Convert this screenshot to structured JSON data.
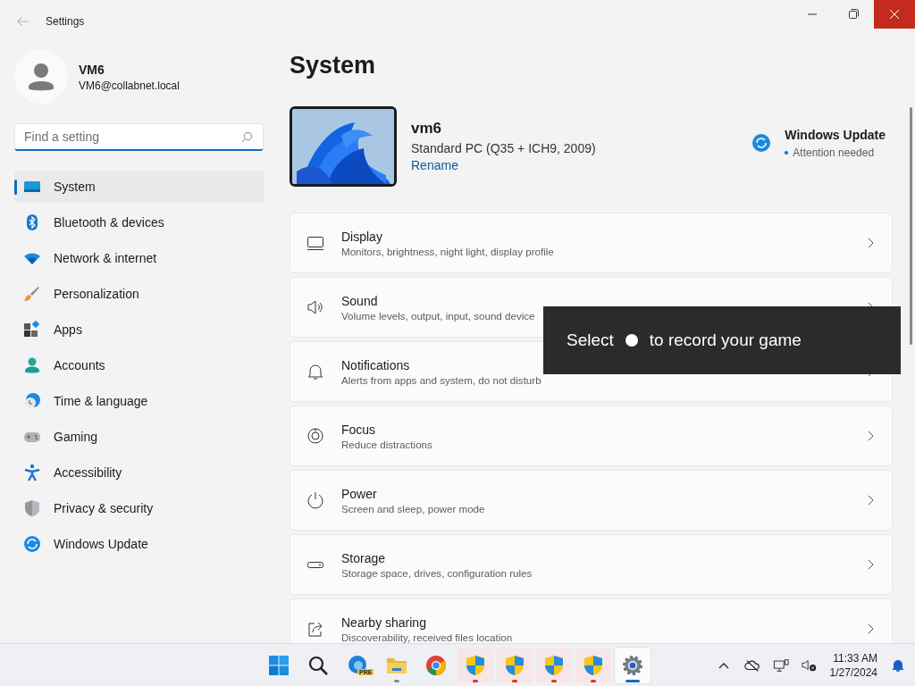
{
  "window": {
    "title": "Settings",
    "close_hovered": true
  },
  "user": {
    "name": "VM6",
    "email": "VM6@collabnet.local"
  },
  "search": {
    "placeholder": "Find a setting"
  },
  "nav": [
    {
      "label": "System",
      "kind": "system",
      "selected": true
    },
    {
      "label": "Bluetooth & devices",
      "kind": "bluetooth",
      "selected": false
    },
    {
      "label": "Network & internet",
      "kind": "wifi",
      "selected": false
    },
    {
      "label": "Personalization",
      "kind": "brush",
      "selected": false
    },
    {
      "label": "Apps",
      "kind": "apps",
      "selected": false
    },
    {
      "label": "Accounts",
      "kind": "person",
      "selected": false
    },
    {
      "label": "Time & language",
      "kind": "clock",
      "selected": false
    },
    {
      "label": "Gaming",
      "kind": "gamepad",
      "selected": false
    },
    {
      "label": "Accessibility",
      "kind": "accessibility",
      "selected": false
    },
    {
      "label": "Privacy & security",
      "kind": "shield",
      "selected": false
    },
    {
      "label": "Windows Update",
      "kind": "update",
      "selected": false
    }
  ],
  "page": {
    "title": "System"
  },
  "device": {
    "name": "vm6",
    "model": "Standard PC (Q35 + ICH9, 2009)",
    "rename": "Rename"
  },
  "update": {
    "title": "Windows Update",
    "status": "Attention needed"
  },
  "cards": [
    {
      "title": "Display",
      "subtitle": "Monitors, brightness, night light, display profile",
      "kind": "display"
    },
    {
      "title": "Sound",
      "subtitle": "Volume levels, output, input, sound device",
      "kind": "sound"
    },
    {
      "title": "Notifications",
      "subtitle": "Alerts from apps and system, do not disturb",
      "kind": "bell"
    },
    {
      "title": "Focus",
      "subtitle": "Reduce distractions",
      "kind": "focus"
    },
    {
      "title": "Power",
      "subtitle": "Screen and sleep, power mode",
      "kind": "power"
    },
    {
      "title": "Storage",
      "subtitle": "Storage space, drives, configuration rules",
      "kind": "storage"
    },
    {
      "title": "Nearby sharing",
      "subtitle": "Discoverability, received files location",
      "kind": "share"
    }
  ],
  "toast": {
    "before": "Select",
    "after": "to record your game"
  },
  "taskbar": {
    "apps": [
      {
        "kind": "start",
        "running": false,
        "attention": false,
        "selected": false
      },
      {
        "kind": "search",
        "running": false,
        "attention": false,
        "selected": false
      },
      {
        "kind": "edge",
        "badge": "PRE",
        "running": false,
        "attention": false,
        "selected": false
      },
      {
        "kind": "folder",
        "running": true,
        "attention": false,
        "selected": false
      },
      {
        "kind": "chrome",
        "running": false,
        "attention": false,
        "selected": false
      },
      {
        "kind": "uac",
        "running": true,
        "attention": true,
        "selected": false
      },
      {
        "kind": "uac",
        "running": true,
        "attention": true,
        "selected": false
      },
      {
        "kind": "uac",
        "running": true,
        "attention": true,
        "selected": false
      },
      {
        "kind": "uac",
        "running": true,
        "attention": true,
        "selected": false
      },
      {
        "kind": "settings",
        "running": true,
        "attention": false,
        "selected": true
      }
    ],
    "time": "11:33 AM",
    "date": "1/27/2024"
  }
}
